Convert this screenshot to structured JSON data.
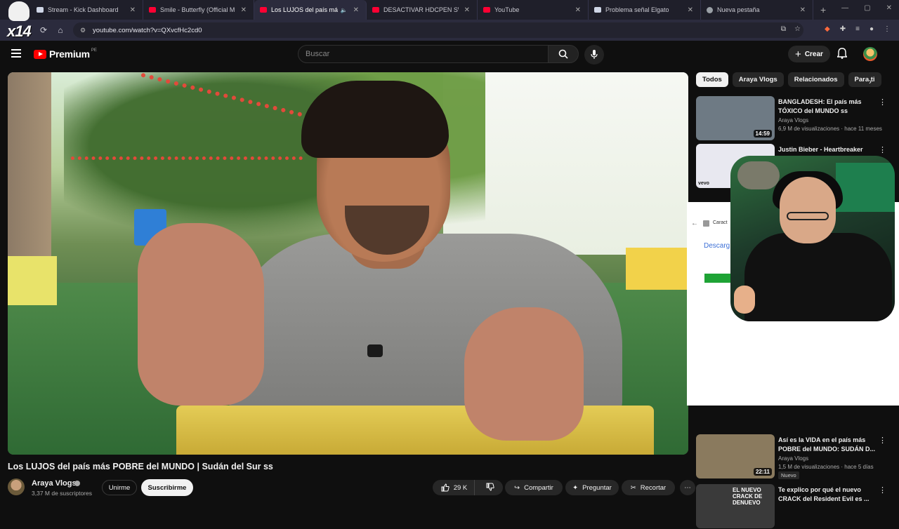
{
  "browser": {
    "tabs": [
      {
        "title": "Stream - Kick Dashboard",
        "fav": "doc",
        "active": false
      },
      {
        "title": "Smile - Butterfly (Official Music",
        "fav": "yt",
        "active": false
      },
      {
        "title": "Los LUJOS del país más PO",
        "fav": "yt",
        "active": true
      },
      {
        "title": "DESACTIVAR HDCPEN SWITCH",
        "fav": "yt",
        "active": false
      },
      {
        "title": "YouTube",
        "fav": "yt",
        "active": false
      },
      {
        "title": "Problema señal Elgato",
        "fav": "doc",
        "active": false
      },
      {
        "title": "Nueva pestaña",
        "fav": "g",
        "active": false
      }
    ],
    "url": "youtube.com/watch?v=QXvcfHc2cd0",
    "overlay_logo_text": "x14"
  },
  "youtube": {
    "logo_label": "Premium",
    "logo_country": "PE",
    "search_placeholder": "Buscar",
    "create_label": "Crear"
  },
  "video": {
    "title": "Los LUJOS del país más POBRE del MUNDO | Sudán del Sur ss",
    "channel": "Araya Vlogs",
    "subscribers": "3,37 M de suscriptores",
    "join_label": "Unirme",
    "subscribe_label": "Suscribirme",
    "likes": "29 K",
    "share_label": "Compartir",
    "ask_label": "Preguntar",
    "clip_label": "Recortar"
  },
  "chips": [
    "Todos",
    "Araya Vlogs",
    "Relacionados",
    "Para ti"
  ],
  "recommendations": [
    {
      "title": "BANGLADESH: El país más TÓXICO del MUNDO ss",
      "channel": "Araya Vlogs",
      "meta": "6,9 M de visualizaciones · hace 11 meses",
      "duration": "14:59",
      "badge": "",
      "thumb_color": "#6e7a84"
    },
    {
      "title": "Justin Bieber - Heartbreaker",
      "channel": "",
      "meta": "",
      "duration": "",
      "badge": "",
      "thumb_color": "#e8e8f0"
    },
    {
      "title": "Así es la VIDA en el país más POBRE del MUNDO: SUDÁN D...",
      "channel": "Araya Vlogs",
      "meta": "1,5 M de visualizaciones · hace 5 días",
      "duration": "22:11",
      "badge": "Nuevo",
      "thumb_color": "#8a7a5e"
    },
    {
      "title": "Te explico por qué el nuevo CRACK del Resident Evil es ...",
      "channel": "",
      "meta": "",
      "duration": "",
      "badge": "",
      "thumb_color": "#3a3a3a"
    }
  ],
  "overlay_panel": {
    "heading": "Caract",
    "link_text": "Descarg"
  },
  "thumb_texts": {
    "vevo": "vevo",
    "nuevo_crack": "EL NUEVO CRACK DE DENUEVO"
  }
}
